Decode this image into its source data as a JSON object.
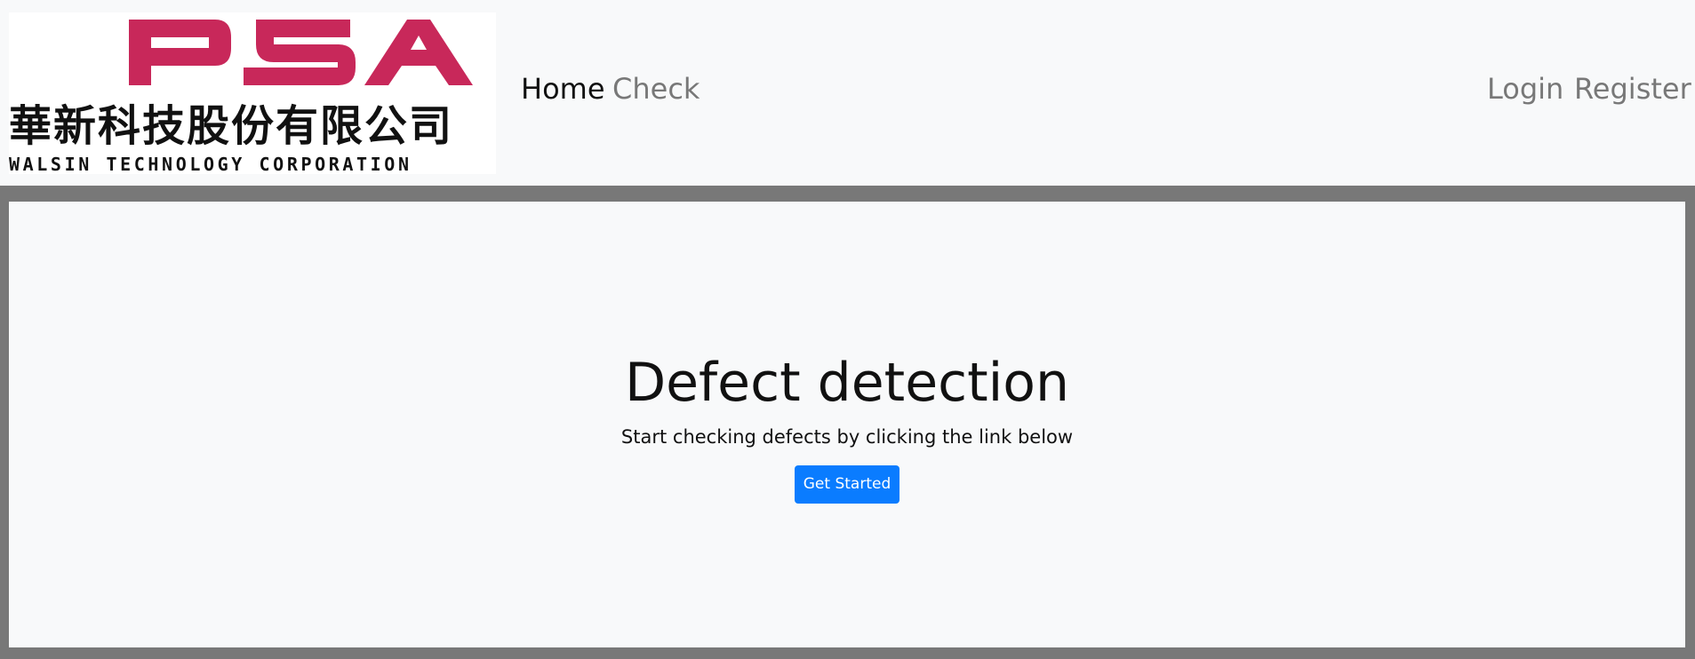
{
  "brand": {
    "logo_text": "PSA",
    "company_name_cn": "華新科技股份有限公司",
    "company_name_en": "WALSIN TECHNOLOGY CORPORATION",
    "logo_color": "#c8285a"
  },
  "nav": {
    "left_items": [
      {
        "label": "Home",
        "active": true
      },
      {
        "label": "Check",
        "active": false
      }
    ],
    "right_items": [
      {
        "label": "Login"
      },
      {
        "label": "Register"
      }
    ]
  },
  "hero": {
    "title": "Defect detection",
    "subtitle": "Start checking defects by clicking the link below",
    "button_label": "Get Started",
    "button_color": "#0a7cff"
  },
  "colors": {
    "navbar_bg": "#f8f9fa",
    "page_border": "#787878",
    "nav_inactive": "#787878",
    "nav_active": "#111111"
  }
}
